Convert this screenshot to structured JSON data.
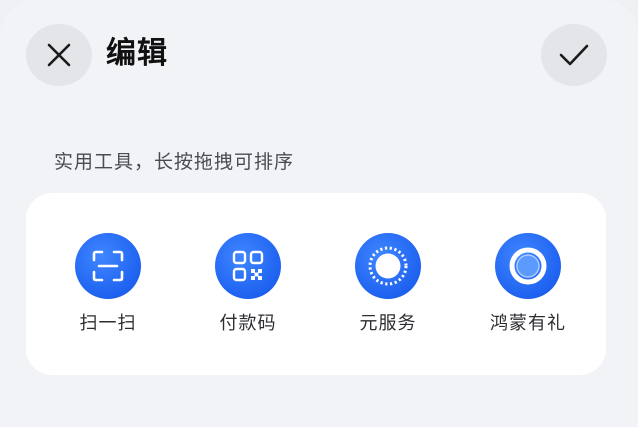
{
  "header": {
    "title": "编辑",
    "close_icon": "close-icon",
    "confirm_icon": "checkmark-icon"
  },
  "section": {
    "label": "实用工具，长按拖拽可排序"
  },
  "tools": [
    {
      "label": "扫一扫",
      "icon": "scan-icon"
    },
    {
      "label": "付款码",
      "icon": "qr-code-icon"
    },
    {
      "label": "元服务",
      "icon": "service-ring-icon"
    },
    {
      "label": "鸿蒙有礼",
      "icon": "gift-ring-icon"
    }
  ],
  "colors": {
    "accent": "#1e62f0",
    "background": "#f1f3f6",
    "card": "#ffffff"
  }
}
